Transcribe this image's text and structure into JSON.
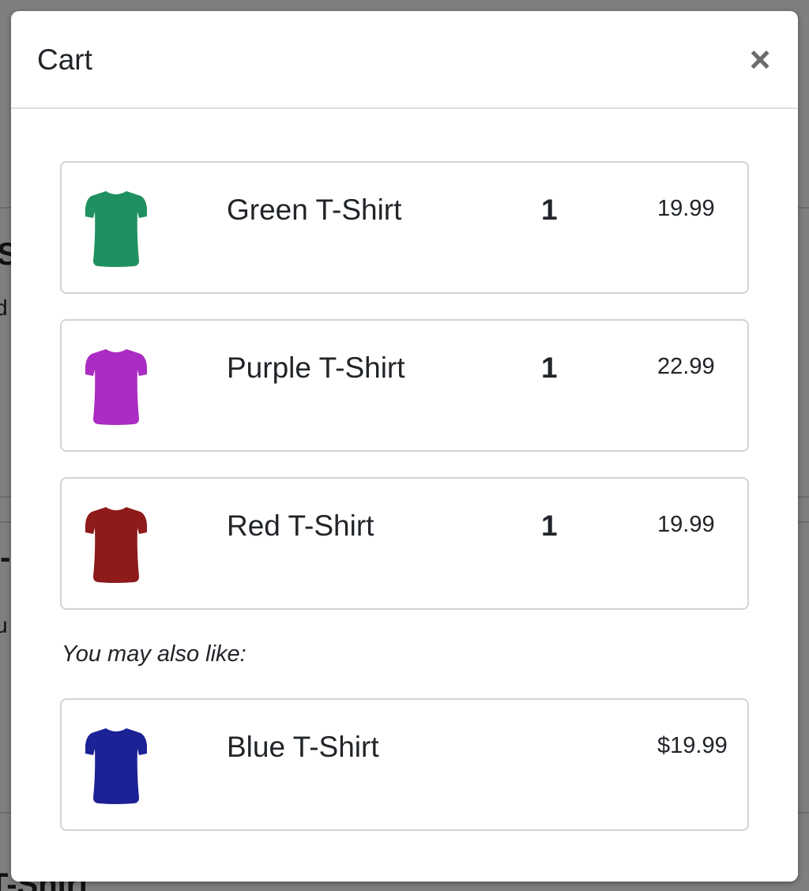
{
  "backdrop": {
    "frag1": "S",
    "frag2": "d",
    "frag3": "-",
    "frag4": "u",
    "frag5": "T-Shirt"
  },
  "modal": {
    "title": "Cart",
    "close_label": "×"
  },
  "cart_items": [
    {
      "name": "Green T-Shirt",
      "quantity": "1",
      "price": "19.99",
      "color": "#1f9160"
    },
    {
      "name": "Purple T-Shirt",
      "quantity": "1",
      "price": "22.99",
      "color": "#ab2cc4"
    },
    {
      "name": "Red T-Shirt",
      "quantity": "1",
      "price": "19.99",
      "color": "#8e1a1a"
    }
  ],
  "suggestions": {
    "label": "You may also like:",
    "items": [
      {
        "name": "Blue T-Shirt",
        "price": "$19.99",
        "color": "#1c2196"
      }
    ]
  }
}
